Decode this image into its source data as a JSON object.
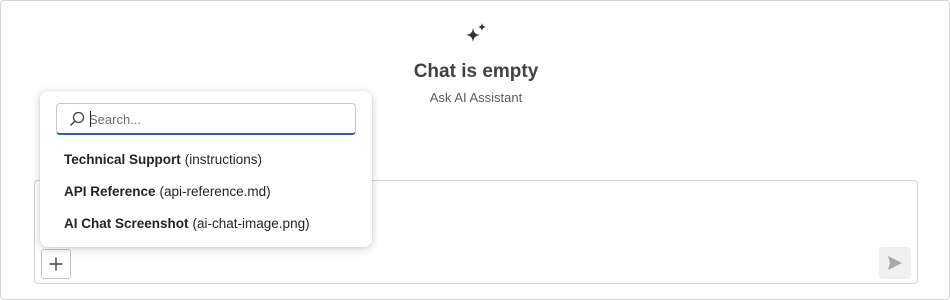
{
  "empty_state": {
    "icon": "sparkle-icon",
    "title": "Chat is empty",
    "subtitle": "Ask AI Assistant"
  },
  "popup": {
    "search": {
      "placeholder": "Search...",
      "value": ""
    },
    "items": [
      {
        "name": "Technical Support",
        "detail": "(instructions)"
      },
      {
        "name": "API Reference",
        "detail": "(api-reference.md)"
      },
      {
        "name": "AI Chat Screenshot",
        "detail": "(ai-chat-image.png)"
      }
    ]
  },
  "composer": {
    "attach_icon": "plus-icon",
    "send_icon": "send-icon"
  },
  "colors": {
    "focus_underline": "#2f5fa8",
    "border": "#d1d1d1",
    "text": "#242424"
  }
}
